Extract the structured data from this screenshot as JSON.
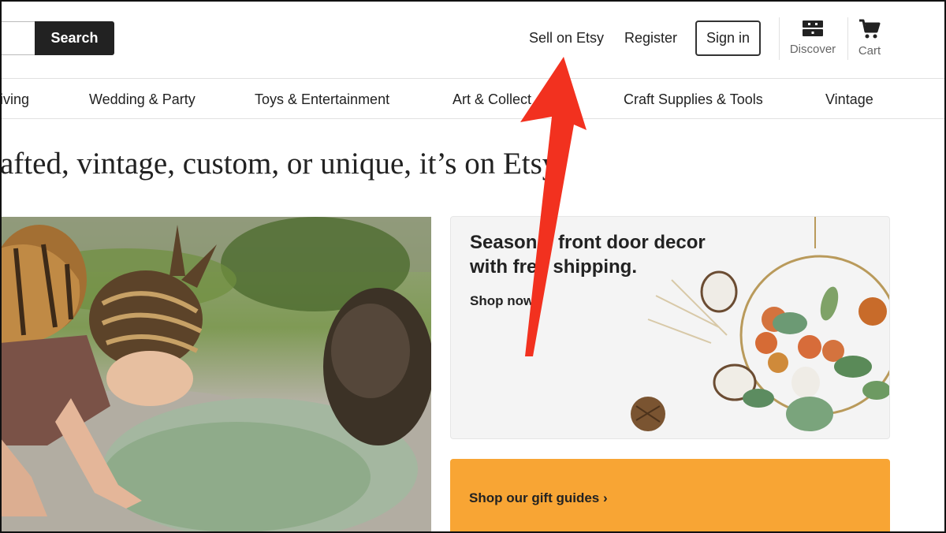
{
  "header": {
    "search_label": "Search",
    "sell_label": "Sell on Etsy",
    "register_label": "Register",
    "signin_label": "Sign in",
    "discover_label": "Discover",
    "cart_label": "Cart"
  },
  "categories": [
    "iving",
    "Wedding & Party",
    "Toys & Entertainment",
    "Art & Collect",
    "Craft Supplies & Tools",
    "Vintage"
  ],
  "hero": {
    "tagline": "afted, vintage, custom, or unique, it’s on Etsy."
  },
  "promo": {
    "title_line1": "Seasonal front door decor",
    "title_line2": "with free shipping.",
    "cta": "Shop now",
    "cta_chevron": "›"
  },
  "gift": {
    "cta": "Shop our gift guides",
    "cta_chevron": "›"
  },
  "icons": {
    "discover": "discover-icon",
    "cart": "cart-icon",
    "annotation": "red-arrow-icon"
  },
  "colors": {
    "search_button": "#222222",
    "gift_banner": "#f8a534",
    "promo_bg": "#f4f4f4",
    "annotation_arrow": "#f2311f"
  }
}
